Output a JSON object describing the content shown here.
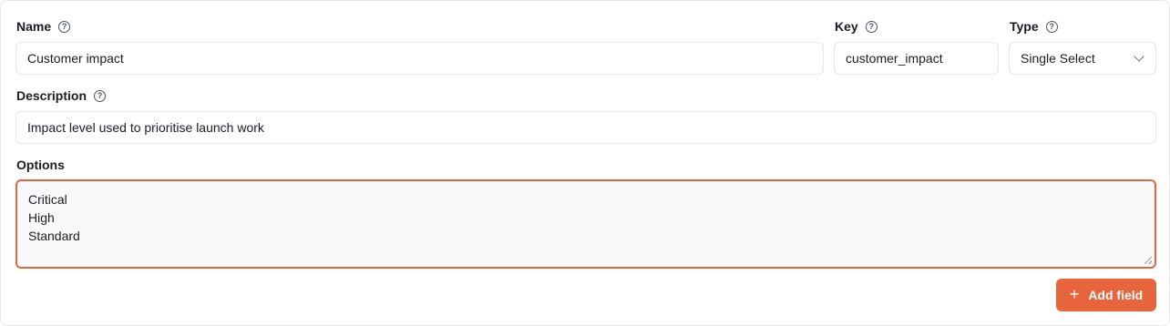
{
  "form": {
    "name": {
      "label": "Name",
      "value": "Customer impact"
    },
    "key": {
      "label": "Key",
      "value": "customer_impact"
    },
    "type": {
      "label": "Type",
      "value": "Single Select"
    },
    "description": {
      "label": "Description",
      "value": "Impact level used to prioritise launch work"
    },
    "options": {
      "label": "Options",
      "lines": [
        "Critical",
        "High",
        "Standard"
      ]
    },
    "help_glyph": "?"
  },
  "actions": {
    "add_field_label": "Add field",
    "plus_glyph": "+"
  },
  "colors": {
    "accent": "#e8643c",
    "border": "#e5e7eb",
    "textarea_bg": "#f8f9fb"
  },
  "icons": [
    "help-icon",
    "chevron-down-icon",
    "plus-icon",
    "resize-grip-icon"
  ]
}
